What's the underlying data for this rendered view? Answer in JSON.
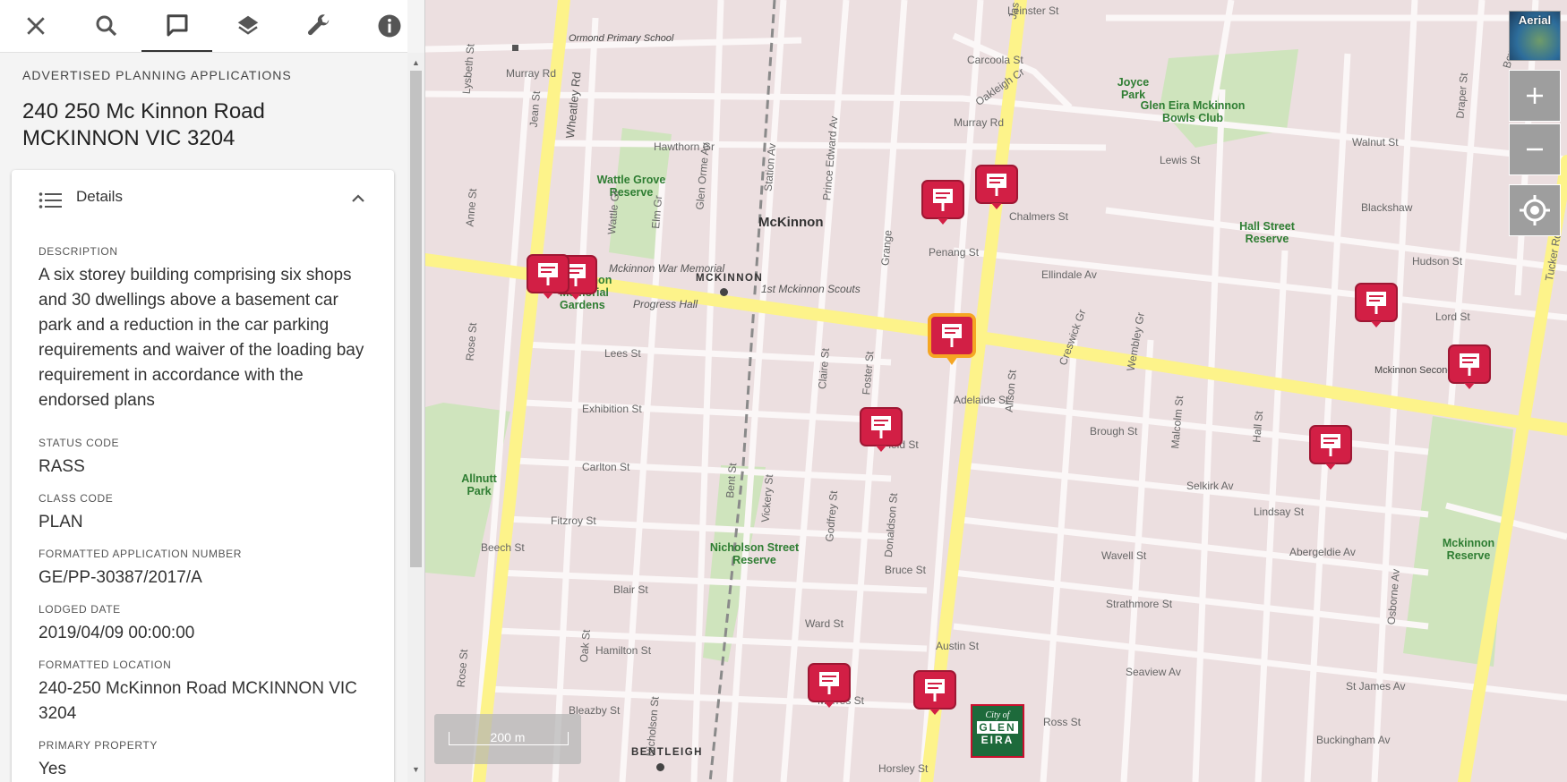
{
  "toolbar": {
    "items": [
      {
        "icon": "close-icon"
      },
      {
        "icon": "search-icon"
      },
      {
        "icon": "chat-icon",
        "active": true
      },
      {
        "icon": "layers-icon"
      },
      {
        "icon": "wrench-icon"
      },
      {
        "icon": "info-icon"
      }
    ]
  },
  "panel": {
    "section_label": "ADVERTISED PLANNING APPLICATIONS",
    "title": "240 250 Mc Kinnon Road MCKINNON VIC 3204",
    "details_label": "Details",
    "fields": [
      {
        "label": "DESCRIPTION",
        "value": "A six storey building comprising six shops and 30 dwellings above a basement car park and a reduction in the car parking requirements and waiver of the loading bay requirement in accordance with the endorsed plans"
      },
      {
        "label": "STATUS CODE",
        "value": "RASS"
      },
      {
        "label": "CLASS CODE",
        "value": "PLAN"
      },
      {
        "label": "FORMATTED APPLICATION NUMBER",
        "value": "GE/PP-30387/2017/A"
      },
      {
        "label": "LODGED DATE",
        "value": "2019/04/09 00:00:00"
      },
      {
        "label": "FORMATTED LOCATION",
        "value": "240-250 McKinnon Road MCKINNON VIC 3204"
      },
      {
        "label": "PRIMARY PROPERTY",
        "value": "Yes"
      }
    ]
  },
  "map": {
    "aerial_label": "Aerial",
    "scale_label": "200 m",
    "logo": {
      "line1": "City of",
      "line2": "GLEN",
      "line3": "EIRA"
    },
    "place_labels": {
      "mckinnon": "McKinnon",
      "mckinnon_station": "MCKINNON",
      "bentleigh": "BENTLEIGH",
      "ormond_primary": "Ormond Primary School",
      "mckinnon_war_memorial": "Mckinnon War Memorial",
      "progress_hall": "Progress Hall",
      "scouts": "1st Mckinnon Scouts",
      "secondary_college": "Mckinnon Secondary Co",
      "wattle_grove": "Wattle Grove Reserve",
      "memorial_gardens": "Mckinnon Memorial Gardens",
      "allnutt_park": "Allnutt Park",
      "nicholson_reserve": "Nicholson Street Reserve",
      "joyce_park": "Joyce Park",
      "bowls_club": "Glen Eira Mckinnon Bowls Club",
      "hall_street_reserve": "Hall Street Reserve",
      "mckinnon_reserve": "Mckinnon Reserve"
    },
    "street_labels": {
      "murray_rd_w": "Murray Rd",
      "murray_rd_e": "Murray Rd",
      "hawthorn_gr": "Hawthorn Gr",
      "lees_st": "Lees St",
      "exhibition_st": "Exhibition St",
      "carlton_st": "Carlton St",
      "fitzroy_st": "Fitzroy St",
      "beech_st": "Beech St",
      "blair_st": "Blair St",
      "hamilton_st": "Hamilton St",
      "bleazby_st": "Bleazby St",
      "ward_st": "Ward St",
      "morres_st": "Morres St",
      "horsley_st": "Horsley St",
      "bruce_st": "Bruce St",
      "field_st": "Field St",
      "adelaide_st": "Adelaide St",
      "penang_st": "Penang St",
      "chalmers_st": "Chalmers St",
      "lewis_st": "Lewis St",
      "walnut_st": "Walnut St",
      "ellindale_av": "Ellindale Av",
      "hudson_st": "Hudson St",
      "lord_st": "Lord St",
      "brough_st": "Brough St",
      "lindsay_st": "Lindsay St",
      "wavell_st": "Wavell St",
      "abergeldie_av": "Abergeldie Av",
      "strathmore_st": "Strathmore St",
      "seaview_av": "Seaview Av",
      "st_james_av": "St James Av",
      "austin_st": "Austin St",
      "ross_st": "Ross St",
      "buckingham_av": "Buckingham Av",
      "selkirk_av": "Selkirk Av",
      "leinster_st": "Leinster St",
      "carcoola_st": "Carcoola St",
      "oakleigh_cr": "Oakleigh Cr",
      "blackshaw": "Blackshaw",
      "wheatley_rd": "Wheatley Rd",
      "jean_st": "Jean St",
      "anne_st": "Anne St",
      "rose_st": "Rose St",
      "elm_gr": "Elm Gr",
      "station_av": "Station Av",
      "glen_orme_av": "Glen Orme Av",
      "prince_edward_av": "Prince Edward Av",
      "claire_st": "Claire St",
      "foster_st": "Foster St",
      "vickery_st": "Vickery St",
      "godfrey_st": "Godfrey St",
      "donaldson_st": "Donaldson St",
      "bent_st": "Bent St",
      "nicholson_st": "Nicholson St",
      "oak_st": "Oak St",
      "alison_st": "Alison St",
      "creswick_gr": "Creswick Gr",
      "wembley_gr": "Wembley Gr",
      "malcolm_st": "Malcolm St",
      "hall_st": "Hall St",
      "osborne_av": "Osborne Av",
      "tucker_rd": "Tucker Rd",
      "draper_st": "Draper St",
      "wattle_gr": "Wattle Gr",
      "lysbeth_st": "Lysbeth St",
      "bewdley_st": "Bewdley St",
      "grange": "Grange",
      "jasper": "Jas"
    }
  }
}
